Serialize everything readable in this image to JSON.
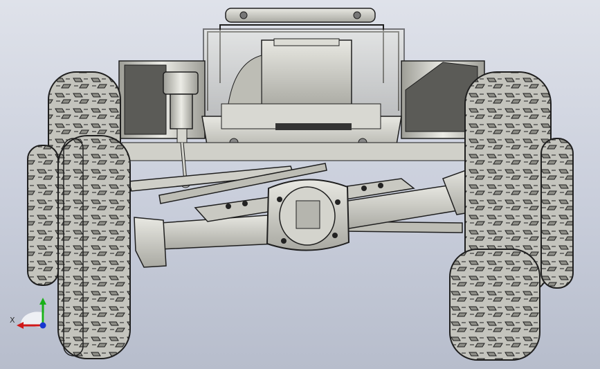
{
  "viewport": {
    "background_top": "#dfe2ea",
    "background_bottom": "#b7bdcc"
  },
  "model": {
    "icon": "rc-crawler-chassis-3d-model",
    "part_color": "#cfcfc8",
    "edge_color": "#1e1e1e",
    "tire_color": "#b9b9b2"
  },
  "triad": {
    "x_label": "X",
    "x_color": "#d01818",
    "y_color": "#18b018",
    "z_color": "#1838d0"
  }
}
